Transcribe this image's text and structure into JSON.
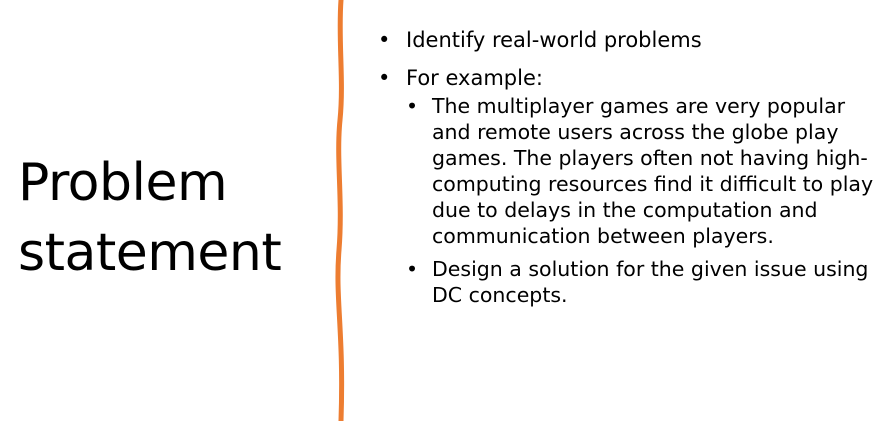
{
  "slide": {
    "title": "Problem statement",
    "bullet_char": "•",
    "colors": {
      "divider": "#ED7D31",
      "text": "#000000",
      "background": "#FFFFFF"
    },
    "bullets": [
      {
        "text": "Identify real-world problems",
        "children": []
      },
      {
        "text": "For example:",
        "children": [
          "The multiplayer games are very popular and remote users across the globe play games. The players often not having high-computing resources find it difficult to play due to delays in the computation and communication between players.",
          "Design a solution for the given issue using DC concepts."
        ]
      }
    ]
  }
}
